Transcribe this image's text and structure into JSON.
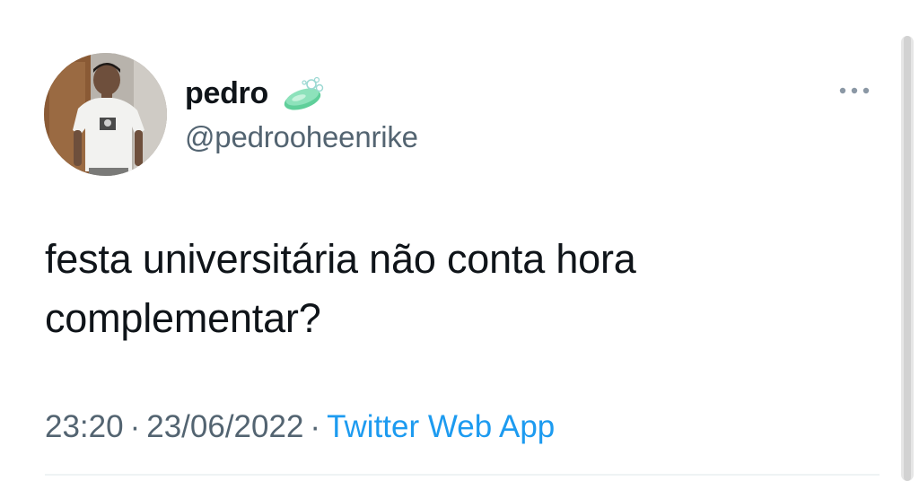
{
  "tweet": {
    "author": {
      "display_name": "pedro",
      "handle": "@pedrooheenrike",
      "badge_emoji": "soap-icon"
    },
    "text": "festa universitária não conta hora complementar?",
    "time": "23:20",
    "separator": "·",
    "date": "23/06/2022",
    "source": "Twitter Web App",
    "more_icon": "ellipsis-icon"
  },
  "colors": {
    "text_primary": "#0f1419",
    "text_secondary": "#536471",
    "link": "#1d9bf0",
    "badge_green": "#5fcf9a"
  }
}
